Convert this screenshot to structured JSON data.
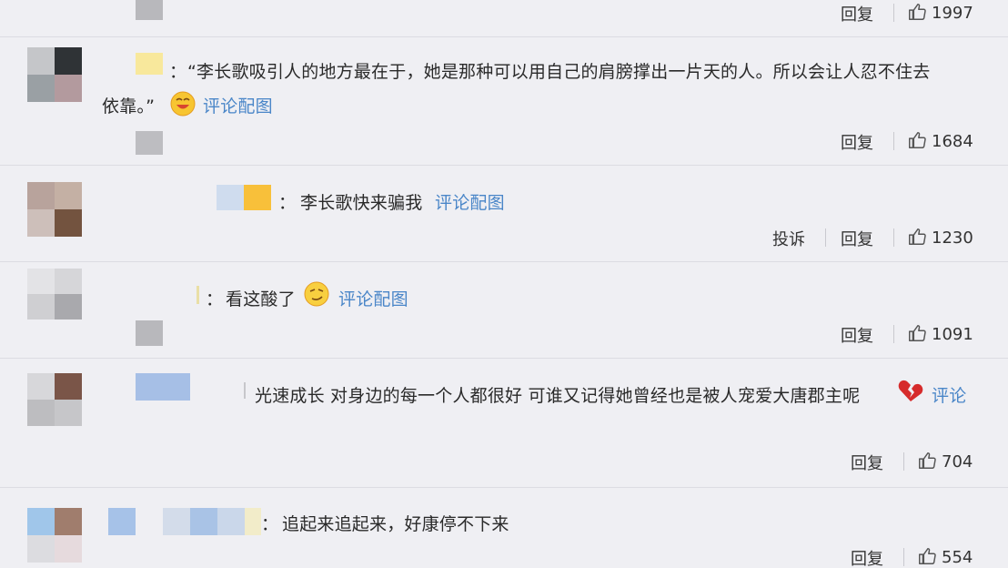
{
  "colors": {
    "background": "#efeff3",
    "link": "#4a86c8",
    "text": "#2a2a2a",
    "divider": "#dcdce2"
  },
  "comments": [
    {
      "actions": {
        "reply": "回复",
        "likes": "1997"
      }
    },
    {
      "sep": "：",
      "line1": "“李长歌吸引人的地方最在于，她是那种可以用自己的肩膀撑出一片天的人。所以会让人忍不住去",
      "line2": "依靠。”",
      "emoji": "grinning-face-icon",
      "link": "评论配图",
      "actions": {
        "reply": "回复",
        "likes": "1684"
      }
    },
    {
      "sep": "：",
      "text": "李长歌快来骗我",
      "link": "评论配图",
      "actions": {
        "report": "投诉",
        "reply": "回复",
        "likes": "1230"
      }
    },
    {
      "sep": "：",
      "text": "看这酸了",
      "emoji": "smirking-face-icon",
      "link": "评论配图",
      "actions": {
        "reply": "回复",
        "likes": "1091"
      }
    },
    {
      "text": "光速成长 对身边的每一个人都很好 可谁又记得她曾经也是被人宠爱大唐郡主呢",
      "emoji": "broken-heart-icon",
      "link": "评论",
      "actions": {
        "reply": "回复",
        "likes": "704"
      }
    },
    {
      "sep": "：",
      "text": "追起来追起来，好康停不下来",
      "actions": {
        "reply": "回复",
        "likes": "554"
      }
    }
  ]
}
